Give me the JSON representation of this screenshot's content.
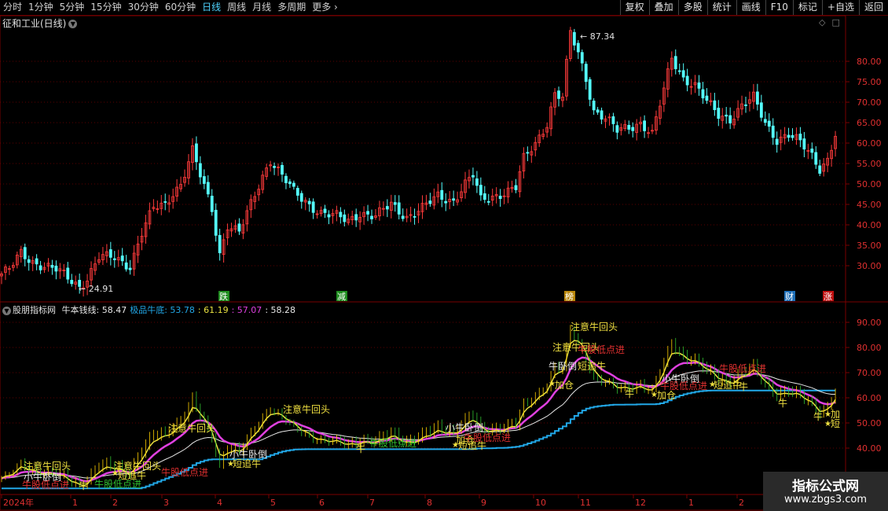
{
  "toolbar": {
    "periods": [
      {
        "label": "分时",
        "active": false
      },
      {
        "label": "1分钟",
        "active": false
      },
      {
        "label": "5分钟",
        "active": false
      },
      {
        "label": "15分钟",
        "active": false
      },
      {
        "label": "30分钟",
        "active": false
      },
      {
        "label": "60分钟",
        "active": false
      },
      {
        "label": "日线",
        "active": true
      },
      {
        "label": "周线",
        "active": false
      },
      {
        "label": "月线",
        "active": false
      },
      {
        "label": "多周期",
        "active": false
      },
      {
        "label": "更多",
        "active": false
      }
    ],
    "actions": [
      "复权",
      "叠加",
      "多股",
      "统计",
      "画线",
      "F10",
      "标记",
      "+自选",
      "返回"
    ]
  },
  "main_chart": {
    "title": "征和工业(日线)",
    "y_ticks": [
      "80.00",
      "75.00",
      "70.00",
      "65.00",
      "60.00",
      "55.00",
      "50.00",
      "45.00",
      "40.00",
      "35.00",
      "30.00"
    ],
    "high_label": "87.34",
    "low_label": "24.91",
    "event_markers": [
      {
        "text": "跌",
        "color": "#1e8c1e"
      },
      {
        "text": "减",
        "color": "#1e8c1e"
      },
      {
        "text": "榜",
        "color": "#b8860b"
      },
      {
        "text": "财",
        "color": "#1e6fb8"
      },
      {
        "text": "涨",
        "color": "#c01010"
      }
    ]
  },
  "indicator": {
    "name": "股朋指标网",
    "items": [
      {
        "label": "牛本钱线:",
        "value": "58.47",
        "color": "#e8e8e8"
      },
      {
        "label": "极品牛底:",
        "value": "53.78",
        "color": "#22a8e8"
      },
      {
        "label": ":",
        "value": "61.19",
        "color": "#e8e040"
      },
      {
        "label": ":",
        "value": "57.07",
        "color": "#e040e0"
      },
      {
        "label": ":",
        "value": "58.28",
        "color": "#e8e8e8"
      }
    ],
    "y_ticks": [
      "90.00",
      "80.00",
      "70.00",
      "60.00",
      "50.00",
      "40.00"
    ],
    "annotations": {
      "watch": "注意牛回头",
      "lying": "小牛卧倒",
      "lying2": "牛卧倒",
      "chase": "短追牛",
      "best": "牛股低点进",
      "add": "加仓",
      "bull": "牛",
      "add_short": "加",
      "short": "短"
    }
  },
  "time_axis": {
    "labels": [
      "2024年",
      "1",
      "2",
      "3",
      "4",
      "5",
      "6",
      "7",
      "8",
      "9",
      "10",
      "11",
      "12",
      "1",
      "2"
    ]
  },
  "watermark": {
    "line1": "指标公式网",
    "line2": "www.zbgs3.com"
  },
  "colors": {
    "up": "#ff3b3b",
    "down": "#54ffff",
    "grid": "#7a0000",
    "bull_floor": "#22a8e8",
    "fast": "#e8e040",
    "mid": "#e040e0",
    "slow": "#e8e8e8"
  },
  "chart_data": {
    "type": "candlestick",
    "title": "征和工业(日线)",
    "ylim": [
      24,
      89
    ],
    "x": [
      "2024年",
      "1",
      "2",
      "3",
      "4",
      "5",
      "6",
      "7",
      "8",
      "9",
      "10",
      "11",
      "12",
      "1",
      "2"
    ],
    "series": [
      {
        "keypoints": [
          [
            0,
            28
          ],
          [
            2,
            29
          ],
          [
            5,
            33
          ],
          [
            8,
            31
          ],
          [
            14,
            29
          ],
          [
            17,
            27
          ],
          [
            20,
            25
          ],
          [
            22,
            27
          ],
          [
            25,
            32
          ],
          [
            29,
            32
          ],
          [
            33,
            30
          ],
          [
            36,
            38
          ],
          [
            39,
            44
          ],
          [
            42,
            45
          ],
          [
            44,
            48
          ],
          [
            46,
            50
          ],
          [
            49,
            58
          ],
          [
            51,
            52
          ],
          [
            54,
            44
          ],
          [
            56,
            33
          ],
          [
            58,
            40
          ],
          [
            61,
            38
          ],
          [
            64,
            45
          ],
          [
            67,
            52
          ],
          [
            69,
            56
          ],
          [
            72,
            52
          ],
          [
            75,
            48
          ],
          [
            79,
            45
          ],
          [
            82,
            43
          ],
          [
            86,
            42
          ],
          [
            89,
            41
          ],
          [
            92,
            43
          ],
          [
            96,
            42
          ],
          [
            100,
            45
          ],
          [
            104,
            42
          ],
          [
            108,
            44
          ],
          [
            112,
            47
          ],
          [
            116,
            46
          ],
          [
            119,
            50
          ],
          [
            121,
            52
          ],
          [
            123,
            46
          ],
          [
            126,
            47
          ],
          [
            129,
            48
          ],
          [
            132,
            49
          ],
          [
            134,
            56
          ],
          [
            137,
            60
          ],
          [
            140,
            65
          ],
          [
            142,
            72
          ],
          [
            144,
            71
          ],
          [
            146,
            87
          ],
          [
            148,
            82
          ],
          [
            150,
            76
          ],
          [
            152,
            68
          ],
          [
            155,
            66
          ],
          [
            158,
            63
          ],
          [
            161,
            64
          ],
          [
            164,
            65
          ],
          [
            167,
            62
          ],
          [
            170,
            73
          ],
          [
            172,
            81
          ],
          [
            175,
            76
          ],
          [
            178,
            74
          ],
          [
            181,
            70
          ],
          [
            184,
            67
          ],
          [
            187,
            66
          ],
          [
            190,
            69
          ],
          [
            193,
            71
          ],
          [
            196,
            65
          ],
          [
            199,
            61
          ],
          [
            202,
            62
          ],
          [
            205,
            60
          ],
          [
            208,
            57
          ],
          [
            210,
            54
          ],
          [
            212,
            56
          ],
          [
            214,
            62
          ]
        ]
      }
    ]
  }
}
